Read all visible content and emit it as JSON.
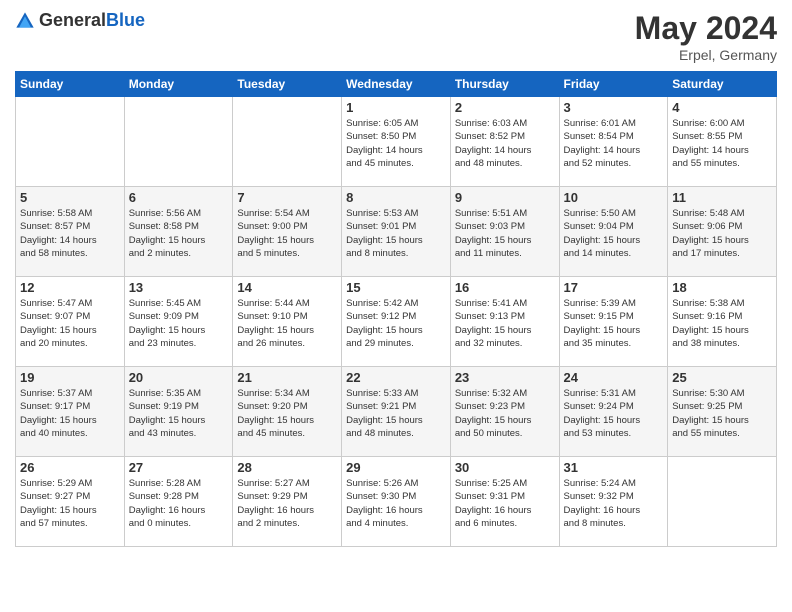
{
  "header": {
    "logo_general": "General",
    "logo_blue": "Blue",
    "month_year": "May 2024",
    "location": "Erpel, Germany"
  },
  "days_of_week": [
    "Sunday",
    "Monday",
    "Tuesday",
    "Wednesday",
    "Thursday",
    "Friday",
    "Saturday"
  ],
  "weeks": [
    [
      {
        "day": "",
        "info": ""
      },
      {
        "day": "",
        "info": ""
      },
      {
        "day": "",
        "info": ""
      },
      {
        "day": "1",
        "info": "Sunrise: 6:05 AM\nSunset: 8:50 PM\nDaylight: 14 hours\nand 45 minutes."
      },
      {
        "day": "2",
        "info": "Sunrise: 6:03 AM\nSunset: 8:52 PM\nDaylight: 14 hours\nand 48 minutes."
      },
      {
        "day": "3",
        "info": "Sunrise: 6:01 AM\nSunset: 8:54 PM\nDaylight: 14 hours\nand 52 minutes."
      },
      {
        "day": "4",
        "info": "Sunrise: 6:00 AM\nSunset: 8:55 PM\nDaylight: 14 hours\nand 55 minutes."
      }
    ],
    [
      {
        "day": "5",
        "info": "Sunrise: 5:58 AM\nSunset: 8:57 PM\nDaylight: 14 hours\nand 58 minutes."
      },
      {
        "day": "6",
        "info": "Sunrise: 5:56 AM\nSunset: 8:58 PM\nDaylight: 15 hours\nand 2 minutes."
      },
      {
        "day": "7",
        "info": "Sunrise: 5:54 AM\nSunset: 9:00 PM\nDaylight: 15 hours\nand 5 minutes."
      },
      {
        "day": "8",
        "info": "Sunrise: 5:53 AM\nSunset: 9:01 PM\nDaylight: 15 hours\nand 8 minutes."
      },
      {
        "day": "9",
        "info": "Sunrise: 5:51 AM\nSunset: 9:03 PM\nDaylight: 15 hours\nand 11 minutes."
      },
      {
        "day": "10",
        "info": "Sunrise: 5:50 AM\nSunset: 9:04 PM\nDaylight: 15 hours\nand 14 minutes."
      },
      {
        "day": "11",
        "info": "Sunrise: 5:48 AM\nSunset: 9:06 PM\nDaylight: 15 hours\nand 17 minutes."
      }
    ],
    [
      {
        "day": "12",
        "info": "Sunrise: 5:47 AM\nSunset: 9:07 PM\nDaylight: 15 hours\nand 20 minutes."
      },
      {
        "day": "13",
        "info": "Sunrise: 5:45 AM\nSunset: 9:09 PM\nDaylight: 15 hours\nand 23 minutes."
      },
      {
        "day": "14",
        "info": "Sunrise: 5:44 AM\nSunset: 9:10 PM\nDaylight: 15 hours\nand 26 minutes."
      },
      {
        "day": "15",
        "info": "Sunrise: 5:42 AM\nSunset: 9:12 PM\nDaylight: 15 hours\nand 29 minutes."
      },
      {
        "day": "16",
        "info": "Sunrise: 5:41 AM\nSunset: 9:13 PM\nDaylight: 15 hours\nand 32 minutes."
      },
      {
        "day": "17",
        "info": "Sunrise: 5:39 AM\nSunset: 9:15 PM\nDaylight: 15 hours\nand 35 minutes."
      },
      {
        "day": "18",
        "info": "Sunrise: 5:38 AM\nSunset: 9:16 PM\nDaylight: 15 hours\nand 38 minutes."
      }
    ],
    [
      {
        "day": "19",
        "info": "Sunrise: 5:37 AM\nSunset: 9:17 PM\nDaylight: 15 hours\nand 40 minutes."
      },
      {
        "day": "20",
        "info": "Sunrise: 5:35 AM\nSunset: 9:19 PM\nDaylight: 15 hours\nand 43 minutes."
      },
      {
        "day": "21",
        "info": "Sunrise: 5:34 AM\nSunset: 9:20 PM\nDaylight: 15 hours\nand 45 minutes."
      },
      {
        "day": "22",
        "info": "Sunrise: 5:33 AM\nSunset: 9:21 PM\nDaylight: 15 hours\nand 48 minutes."
      },
      {
        "day": "23",
        "info": "Sunrise: 5:32 AM\nSunset: 9:23 PM\nDaylight: 15 hours\nand 50 minutes."
      },
      {
        "day": "24",
        "info": "Sunrise: 5:31 AM\nSunset: 9:24 PM\nDaylight: 15 hours\nand 53 minutes."
      },
      {
        "day": "25",
        "info": "Sunrise: 5:30 AM\nSunset: 9:25 PM\nDaylight: 15 hours\nand 55 minutes."
      }
    ],
    [
      {
        "day": "26",
        "info": "Sunrise: 5:29 AM\nSunset: 9:27 PM\nDaylight: 15 hours\nand 57 minutes."
      },
      {
        "day": "27",
        "info": "Sunrise: 5:28 AM\nSunset: 9:28 PM\nDaylight: 16 hours\nand 0 minutes."
      },
      {
        "day": "28",
        "info": "Sunrise: 5:27 AM\nSunset: 9:29 PM\nDaylight: 16 hours\nand 2 minutes."
      },
      {
        "day": "29",
        "info": "Sunrise: 5:26 AM\nSunset: 9:30 PM\nDaylight: 16 hours\nand 4 minutes."
      },
      {
        "day": "30",
        "info": "Sunrise: 5:25 AM\nSunset: 9:31 PM\nDaylight: 16 hours\nand 6 minutes."
      },
      {
        "day": "31",
        "info": "Sunrise: 5:24 AM\nSunset: 9:32 PM\nDaylight: 16 hours\nand 8 minutes."
      },
      {
        "day": "",
        "info": ""
      }
    ]
  ]
}
